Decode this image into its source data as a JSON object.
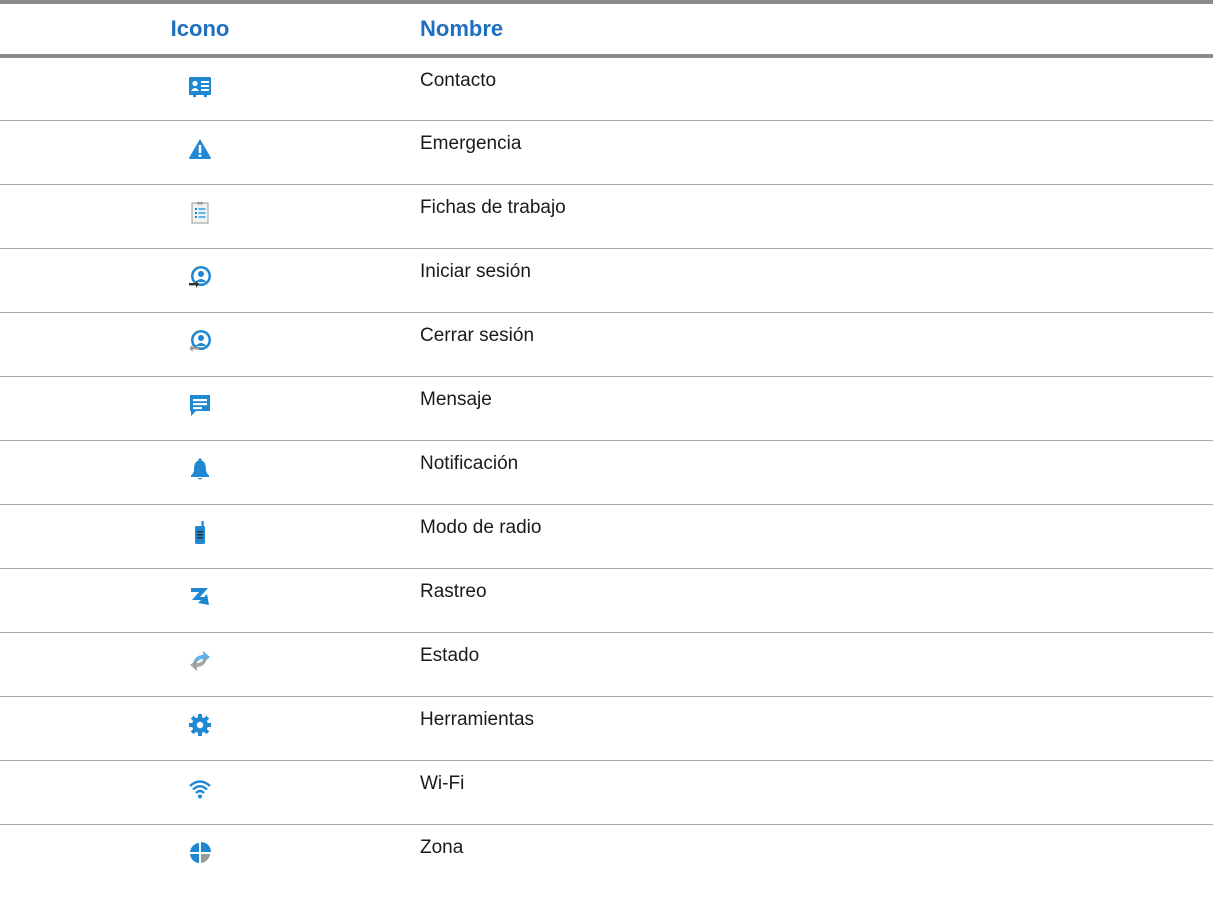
{
  "table": {
    "headers": {
      "icon": "Icono",
      "name": "Nombre"
    },
    "rows": [
      {
        "icon": "contact-card-icon",
        "name": "Contacto"
      },
      {
        "icon": "warning-triangle-icon",
        "name": "Emergencia"
      },
      {
        "icon": "job-ticket-icon",
        "name": "Fichas de trabajo"
      },
      {
        "icon": "login-user-icon",
        "name": "Iniciar sesión"
      },
      {
        "icon": "logout-user-icon",
        "name": "Cerrar sesión"
      },
      {
        "icon": "message-icon",
        "name": "Mensaje"
      },
      {
        "icon": "bell-icon",
        "name": "Notificación"
      },
      {
        "icon": "radio-icon",
        "name": "Modo de radio"
      },
      {
        "icon": "tracking-icon",
        "name": "Rastreo"
      },
      {
        "icon": "status-refresh-icon",
        "name": "Estado"
      },
      {
        "icon": "gear-icon",
        "name": "Herramientas"
      },
      {
        "icon": "wifi-icon",
        "name": "Wi-Fi"
      },
      {
        "icon": "zone-pie-icon",
        "name": "Zona"
      }
    ]
  },
  "colors": {
    "header_text": "#1f6fc0",
    "icon_blue": "#1e88d2",
    "icon_light_blue": "#5bb4ee",
    "icon_gray": "#9a9a9a",
    "rule_dark": "#8c8c8c",
    "rule_light": "#a8a8a8"
  }
}
